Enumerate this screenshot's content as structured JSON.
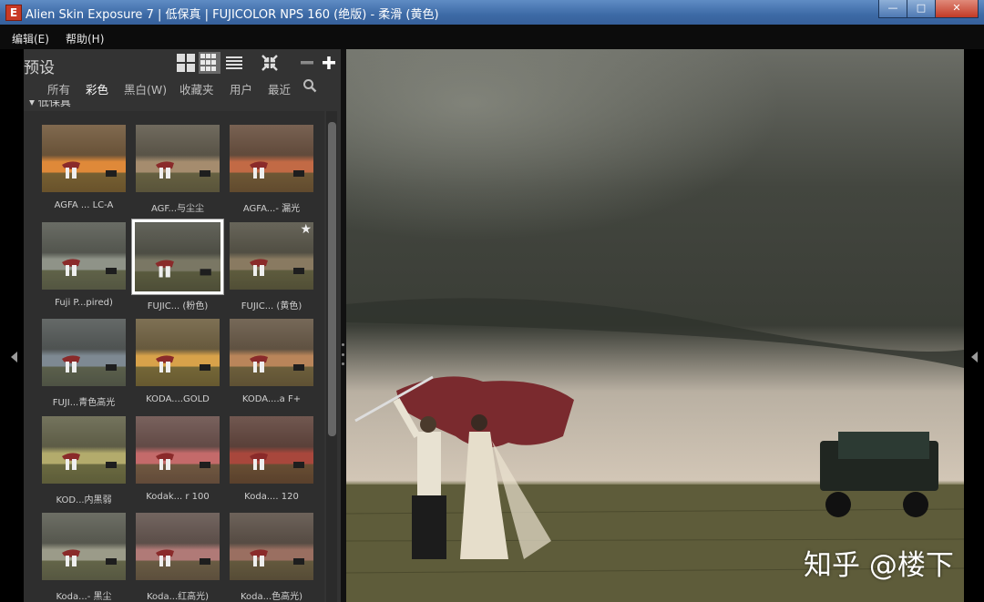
{
  "window": {
    "icon_glyph": "E",
    "title": "Alien Skin Exposure 7 | 低保真 | FUJICOLOR NPS 160 (绝版) - 柔滑 (黄色)",
    "buttons": {
      "minimize": "—",
      "maximize": "□",
      "close": "✕"
    }
  },
  "menubar": {
    "items": [
      "编辑(E)",
      "帮助(H)"
    ]
  },
  "presets": {
    "title": "预设",
    "toolbar_icons": [
      "large-grid-icon",
      "small-grid-icon",
      "list-view-icon",
      "collapse-all-icon",
      "minus-icon",
      "plus-icon"
    ],
    "tabs": [
      "所有",
      "彩色",
      "黑白(W)",
      "收藏夹",
      "用户",
      "最近"
    ],
    "active_tab": "彩色",
    "section": "低保真",
    "items": [
      {
        "label": "AGFA ... LC-A",
        "tone": "#e08a3a",
        "selected": false,
        "starred": false
      },
      {
        "label": "AGF...与尘尘",
        "tone": "#a58d6e",
        "selected": false,
        "starred": false
      },
      {
        "label": "AGFA...- 漏光",
        "tone": "#c26a46",
        "selected": false,
        "starred": false
      },
      {
        "label": "Fuji P...pired)",
        "tone": "#8f9488",
        "selected": false,
        "starred": false
      },
      {
        "label": "FUJIC... (粉色)",
        "tone": "#7a7865",
        "selected": true,
        "starred": false
      },
      {
        "label": "FUJIC... (黄色)",
        "tone": "#8a7b62",
        "selected": false,
        "starred": true
      },
      {
        "label": "FUJI...青色高光",
        "tone": "#7f8a92",
        "selected": false,
        "starred": false
      },
      {
        "label": "KODA....GOLD",
        "tone": "#d9a24a",
        "selected": false,
        "starred": false
      },
      {
        "label": "KODA....a F+",
        "tone": "#b9865a",
        "selected": false,
        "starred": false
      },
      {
        "label": "KOD...内黑弱",
        "tone": "#b3ab6d",
        "selected": false,
        "starred": false
      },
      {
        "label": "Kodak... r 100",
        "tone": "#c46a6a",
        "selected": false,
        "starred": false
      },
      {
        "label": "Koda.... 120",
        "tone": "#a8473c",
        "selected": false,
        "starred": false
      },
      {
        "label": "Koda...- 黑尘",
        "tone": "#9c9c8a",
        "selected": false,
        "starred": false
      },
      {
        "label": "Koda...红高光)",
        "tone": "#b07a78",
        "selected": false,
        "starred": false
      },
      {
        "label": "Koda...色高光)",
        "tone": "#9a7062",
        "selected": false,
        "starred": false
      }
    ]
  },
  "preview": {
    "sky_color": "#3a3d36",
    "horizon_color": "#c8bfb0",
    "grass_color": "#5a5a38"
  },
  "watermark": "知乎 @楼下"
}
